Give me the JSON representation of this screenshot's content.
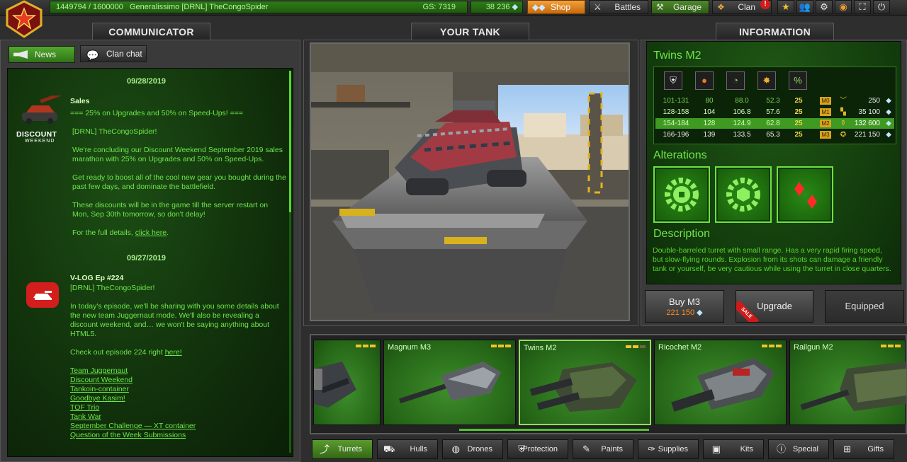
{
  "topbar": {
    "xp": "1449794 / 1600000",
    "rank": "Generalissimo",
    "player": "[DRNL] TheCongoSpider",
    "gs": "GS: 7319",
    "crystals": "38 236",
    "shop": "Shop",
    "battles": "Battles",
    "garage": "Garage",
    "clan": "Clan",
    "clan_badge": "!"
  },
  "communicator": {
    "title": "COMMUNICATOR",
    "tabs": {
      "news": "News",
      "clan_chat": "Clan chat"
    },
    "posts": [
      {
        "date": "09/28/2019",
        "logo_line1": "DISCOUNT",
        "logo_line2": "WEEKEND",
        "title": "Sales",
        "subtitle": "=== 25% on Upgrades and 50% on Speed-Ups! ===",
        "author": "[DRNL] TheCongoSpider!",
        "p1": "We're concluding our Discount Weekend September 2019 sales marathon with 25% on Upgrades and 50% on Speed-Ups.",
        "p2": "Get ready to boost all of the cool new gear you bought during the past few days, and dominate the battlefield.",
        "p3": "These discounts will be in the game till the server restart on Mon, Sep 30th tomorrow, so don't delay!",
        "p4": "For the full details,",
        "p4_link": "click here",
        "p4_end": "."
      },
      {
        "date": "09/27/2019",
        "title": "V-LOG Ep #224",
        "author": "[DRNL] TheCongoSpider!",
        "p1": "In today's episode, we'll be sharing with you some details about the new team Juggernaut mode. We'll also be revealing a discount weekend, and… we won't be saying anything about HTML5.",
        "p2": "Check out episode 224 right",
        "p2_link": "here!",
        "links": [
          "Team Juggernaut",
          "Discount Weekend",
          "Tankoin-container",
          "Goodbye Kasim!",
          "TOF Trio",
          "Tank War",
          "September Challenge — XT container",
          "Question of the Week Submissions"
        ]
      }
    ]
  },
  "yourtank": {
    "title": "YOUR TANK"
  },
  "information": {
    "title": "INFORMATION",
    "item_name": "Twins M2",
    "stats": [
      {
        "a": "101-131",
        "b": "80",
        "c": "88.0",
        "d": "52.3",
        "e": "25",
        "m": "M0",
        "price": "250"
      },
      {
        "a": "128-158",
        "b": "104",
        "c": "106.8",
        "d": "57.6",
        "e": "25",
        "m": "M1",
        "price": "35 100"
      },
      {
        "a": "154-184",
        "b": "128",
        "c": "124.9",
        "d": "62.8",
        "e": "25",
        "m": "M2",
        "price": "132 600"
      },
      {
        "a": "166-196",
        "b": "139",
        "c": "133.5",
        "d": "65.3",
        "e": "25",
        "m": "M3",
        "price": "221 150"
      }
    ],
    "alterations_title": "Alterations",
    "description_title": "Description",
    "description": "Double-barreled turret with small range. Has a very rapid firing speed, but slow-flying rounds. Explosion from its shots can damage a friendly tank or yourself, be very cautious while using the turret in close quarters.",
    "buy_label": "Buy M3",
    "buy_price": "221 150",
    "upgrade_label": "Upgrade",
    "sale_tag": "SALE",
    "equipped_label": "Equipped"
  },
  "items": [
    {
      "name": ""
    },
    {
      "name": "Magnum M3"
    },
    {
      "name": "Twins M2"
    },
    {
      "name": "Ricochet M2"
    },
    {
      "name": "Railgun M2"
    }
  ],
  "categories": [
    "Turrets",
    "Hulls",
    "Drones",
    "Protection",
    "Paints",
    "Supplies",
    "Kits",
    "Special",
    "Gifts"
  ],
  "colors": {
    "accent_green": "#6de54a",
    "orange": "#f4a13b",
    "price_orange": "#ff8a1e"
  }
}
